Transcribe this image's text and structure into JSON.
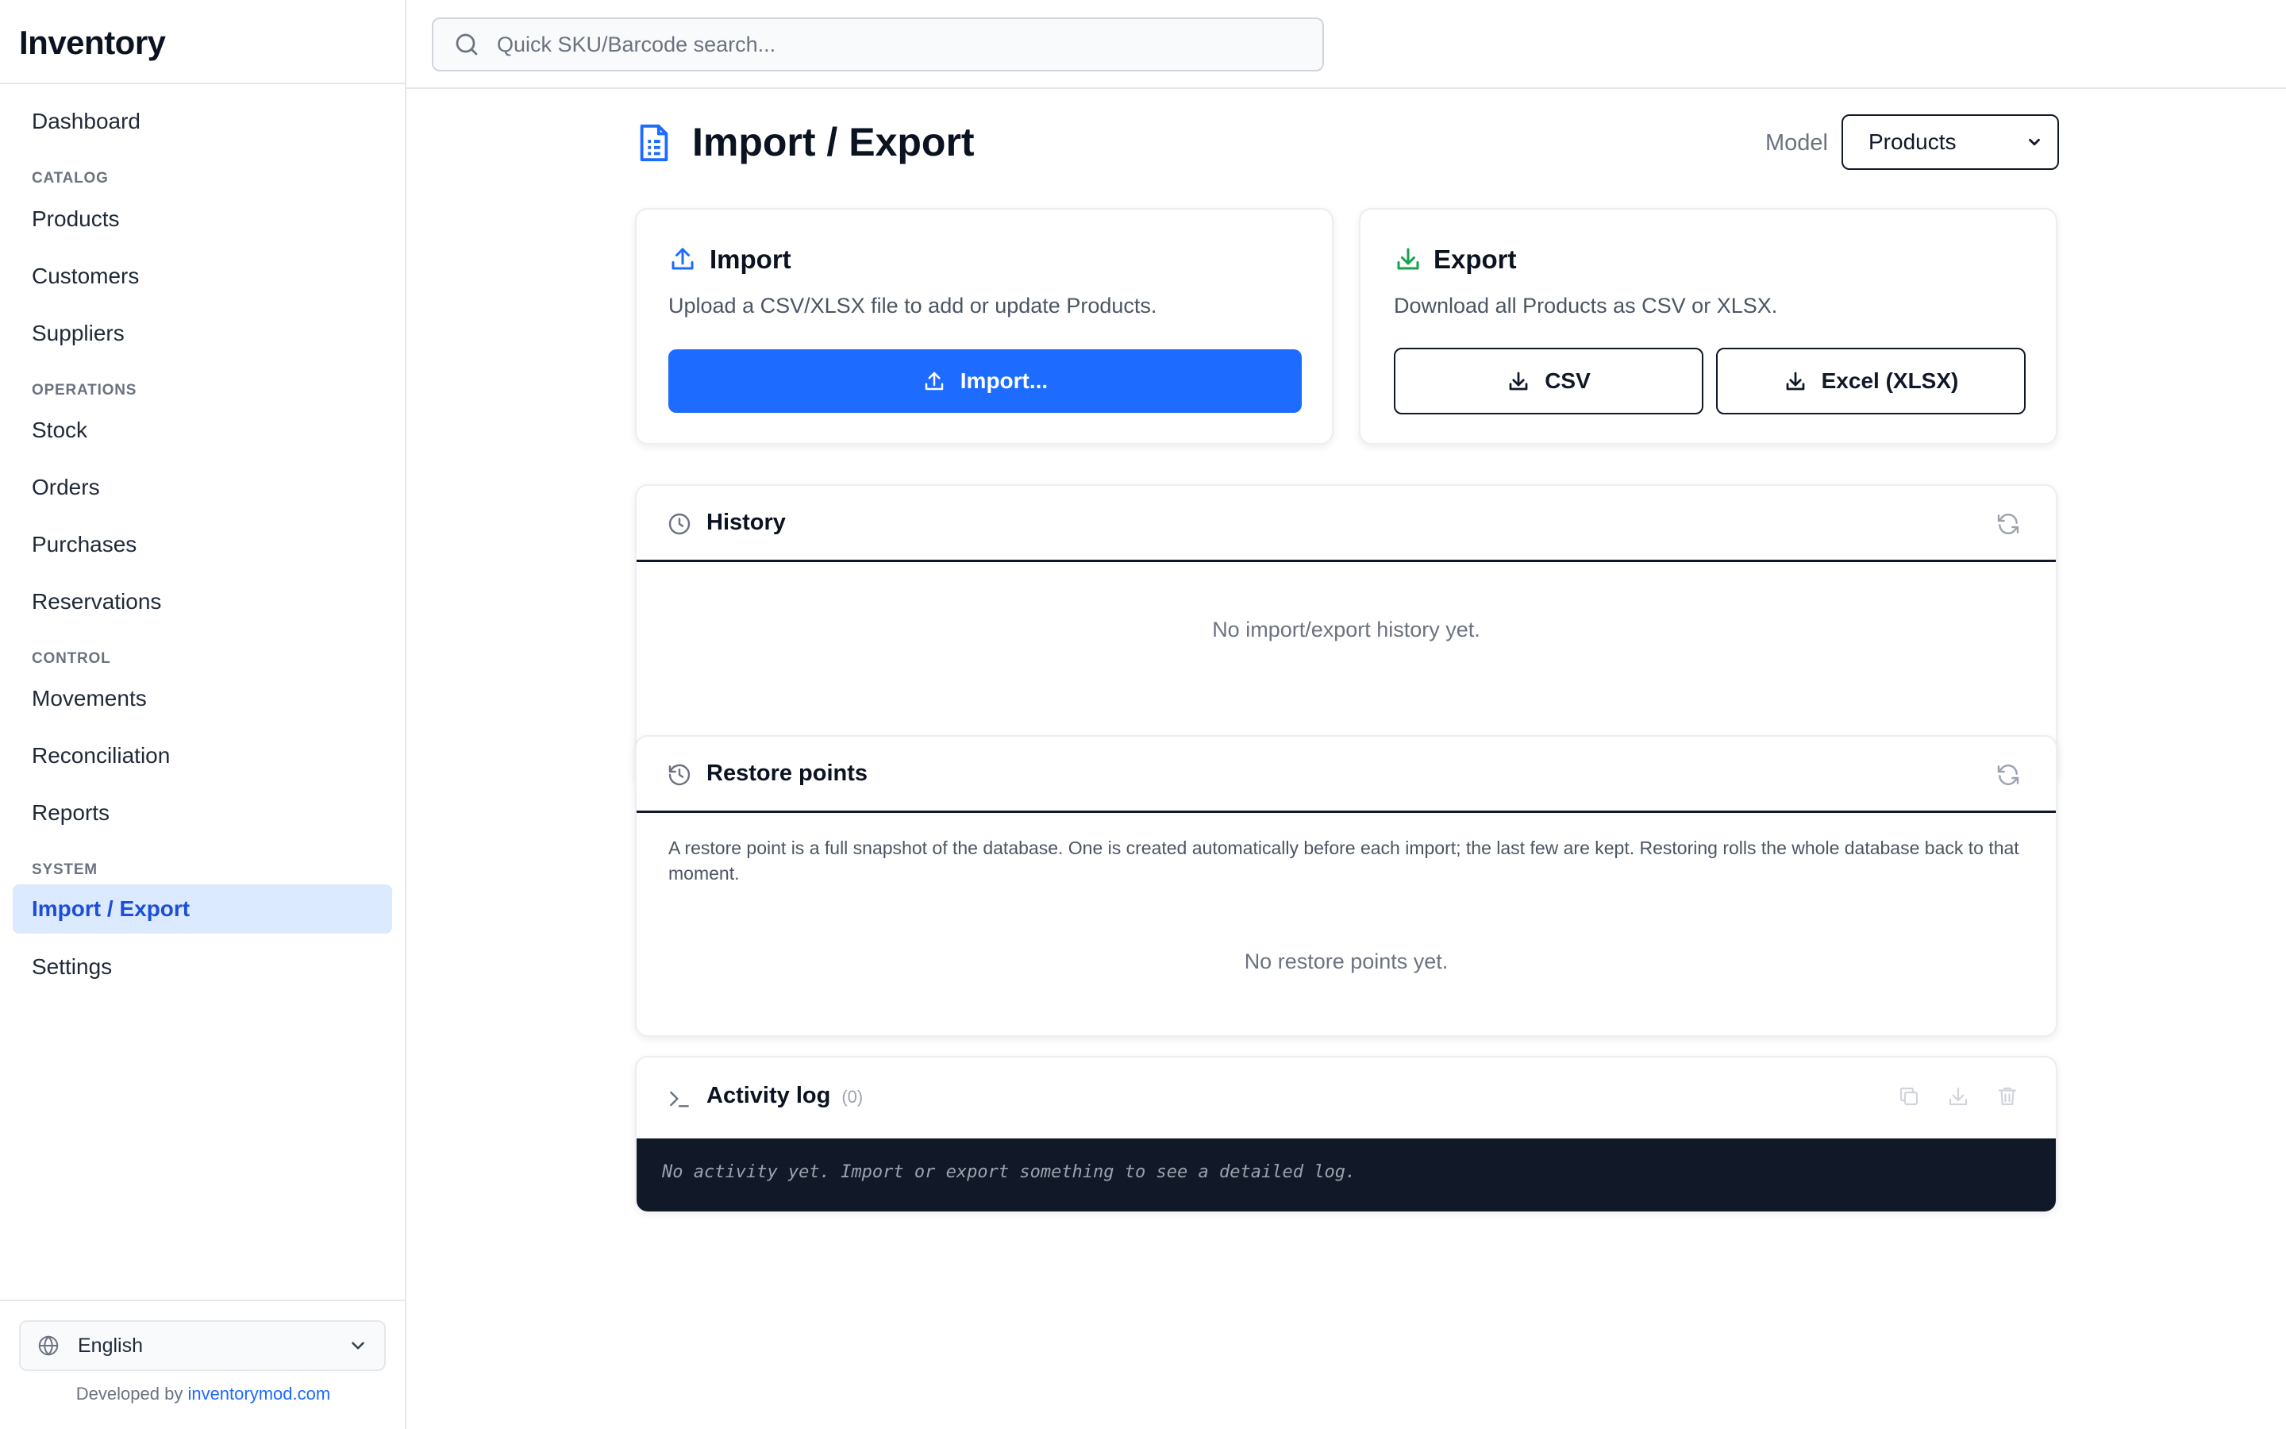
{
  "app": {
    "brand": "Inventory"
  },
  "sidebar": {
    "items": [
      {
        "label": "Dashboard"
      },
      {
        "section": "CATALOG"
      },
      {
        "label": "Products"
      },
      {
        "label": "Customers"
      },
      {
        "label": "Suppliers"
      },
      {
        "section": "OPERATIONS"
      },
      {
        "label": "Stock"
      },
      {
        "label": "Orders"
      },
      {
        "label": "Purchases"
      },
      {
        "label": "Reservations"
      },
      {
        "section": "CONTROL"
      },
      {
        "label": "Movements"
      },
      {
        "label": "Reconciliation"
      },
      {
        "label": "Reports"
      },
      {
        "section": "SYSTEM"
      },
      {
        "label": "Import / Export",
        "active": true
      },
      {
        "label": "Settings"
      }
    ],
    "language": "English",
    "developed_by_prefix": "Developed by",
    "developed_by_link": "inventorymod.com"
  },
  "topbar": {
    "search_placeholder": "Quick SKU/Barcode search..."
  },
  "page": {
    "title": "Import / Export",
    "model_label": "Model",
    "model_value": "Products"
  },
  "import_card": {
    "title": "Import",
    "description": "Upload a CSV/XLSX file to add or update Products.",
    "button": "Import..."
  },
  "export_card": {
    "title": "Export",
    "description": "Download all Products as CSV or XLSX.",
    "csv_button": "CSV",
    "xlsx_button": "Excel (XLSX)"
  },
  "history": {
    "title": "History",
    "empty": "No import/export history yet."
  },
  "restore_points": {
    "title": "Restore points",
    "note": "A restore point is a full snapshot of the database. One is created automatically before each import; the last few are kept. Restoring rolls the whole database back to that moment.",
    "empty": "No restore points yet."
  },
  "activity_log": {
    "title": "Activity log",
    "count": "(0)",
    "empty": "No activity yet. Import or export something to see a detailed log."
  },
  "colors": {
    "accent": "#1d6bff",
    "export_icon": "#16a34a",
    "active_bg": "#dbeafe",
    "log_bg": "#111827"
  },
  "icons": {
    "search": "search-icon",
    "page": "document-icon",
    "import": "upload-icon",
    "export": "download-icon",
    "history": "clock-icon",
    "restore": "history-icon",
    "refresh": "refresh-icon",
    "terminal": "terminal-icon",
    "copy": "copy-icon",
    "trash": "trash-icon",
    "globe": "globe-icon",
    "chevron": "chevron-down-icon"
  }
}
